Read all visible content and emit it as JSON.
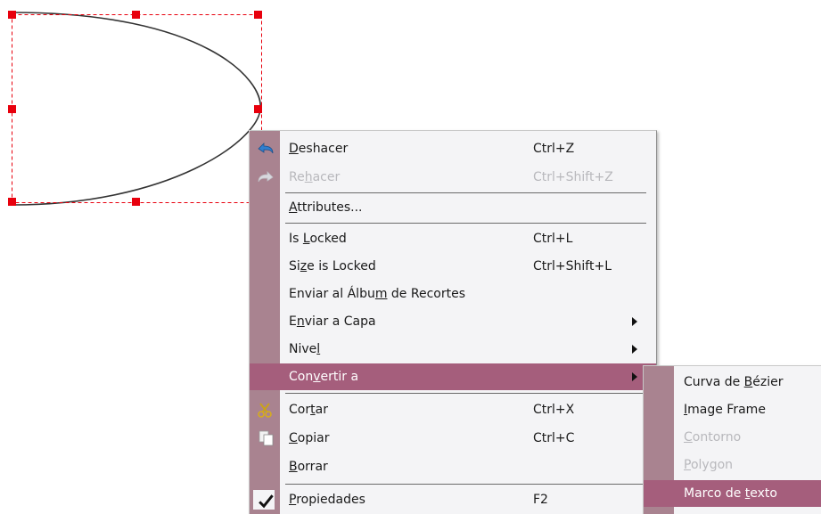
{
  "context_menu": {
    "items": [
      {
        "label_pre": "",
        "label_u": "D",
        "label_post": "eshacer",
        "accel": "Ctrl+Z",
        "icon": "undo-icon"
      },
      {
        "label_pre": "Re",
        "label_u": "h",
        "label_post": "acer",
        "accel": "Ctrl+Shift+Z",
        "icon": "redo-icon"
      },
      {
        "label_pre": "",
        "label_u": "A",
        "label_post": "ttributes...",
        "accel": ""
      },
      {
        "label_pre": "Is ",
        "label_u": "L",
        "label_post": "ocked",
        "accel": "Ctrl+L"
      },
      {
        "label_pre": "Si",
        "label_u": "z",
        "label_post": "e is Locked",
        "accel": "Ctrl+Shift+L"
      },
      {
        "label_pre": "Enviar al Álbu",
        "label_u": "m",
        "label_post": " de Recortes",
        "accel": ""
      },
      {
        "label_pre": "E",
        "label_u": "n",
        "label_post": "viar a Capa",
        "accel": ""
      },
      {
        "label_pre": "Nive",
        "label_u": "l",
        "label_post": "",
        "accel": ""
      },
      {
        "label_pre": "Con",
        "label_u": "v",
        "label_post": "ertir a",
        "accel": ""
      },
      {
        "label_pre": "Cor",
        "label_u": "t",
        "label_post": "ar",
        "accel": "Ctrl+X",
        "icon": "scissors-icon"
      },
      {
        "label_pre": "",
        "label_u": "C",
        "label_post": "opiar",
        "accel": "Ctrl+C",
        "icon": "copy-icon"
      },
      {
        "label_pre": "",
        "label_u": "B",
        "label_post": "orrar",
        "accel": ""
      },
      {
        "label_pre": "",
        "label_u": "P",
        "label_post": "ropiedades",
        "accel": "F2",
        "icon": "checkmark-icon"
      }
    ]
  },
  "submenu": {
    "items": [
      {
        "label_pre": "Curva de ",
        "label_u": "B",
        "label_post": "ézier"
      },
      {
        "label_pre": "",
        "label_u": "I",
        "label_post": "mage Frame"
      },
      {
        "label_pre": "",
        "label_u": "C",
        "label_post": "ontorno"
      },
      {
        "label_pre": "",
        "label_u": "P",
        "label_post": "olygon"
      },
      {
        "label_pre": "Marco de ",
        "label_u": "t",
        "label_post": "exto"
      }
    ]
  },
  "colors": {
    "highlight": "#a55e7c",
    "gutter": "#a98390",
    "menu_bg": "#f4f4f6",
    "handle": "#e8000d"
  }
}
